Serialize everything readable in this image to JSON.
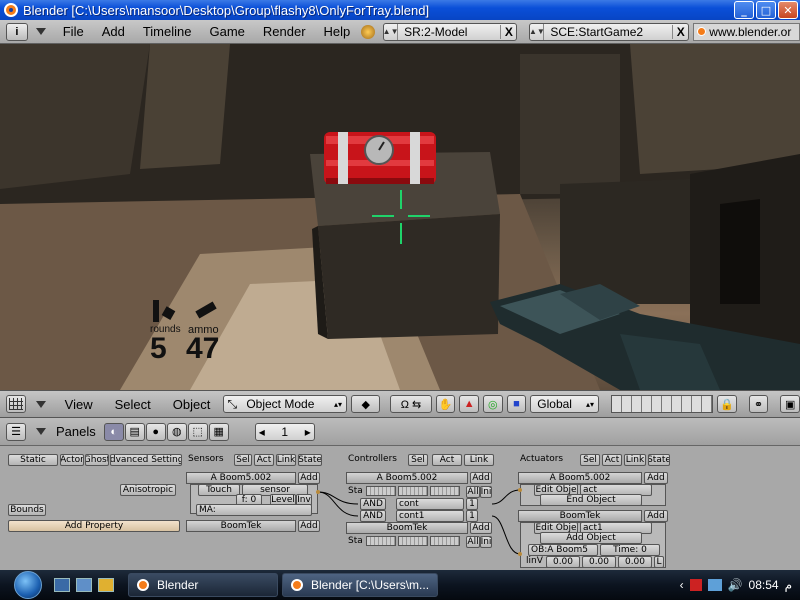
{
  "window": {
    "title": "Blender [C:\\Users\\mansoor\\Desktop\\Group\\flashy8\\OnlyForTray.blend]",
    "min": "_",
    "max": "□",
    "close": "✕"
  },
  "menubar": {
    "info_icon": "i",
    "items": [
      "File",
      "Add",
      "Timeline",
      "Game",
      "Render",
      "Help"
    ],
    "screen_field": "SR:2-Model",
    "scene_field": "SCE:StartGame2",
    "url": "www.blender.or"
  },
  "hud": {
    "rounds_label": "rounds",
    "rounds_value": "5",
    "ammo_label": "ammo",
    "ammo_value": "47"
  },
  "view_header": {
    "menus": [
      "View",
      "Select",
      "Object"
    ],
    "mode": "Object Mode",
    "orientation": "Global"
  },
  "panels_header": {
    "panels_label": "Panels",
    "page_value": "1"
  },
  "logic": {
    "object_buttons": [
      "Static",
      "Actor",
      "Ghost",
      "Advanced Settings"
    ],
    "anisotropic": "Anisotropic",
    "bounds": "Bounds",
    "add_property": "Add Property",
    "sensors": {
      "title": "Sensors",
      "filters": [
        "Sel",
        "Act",
        "Link",
        "State"
      ],
      "object": "A Boom5.002",
      "add": "Add",
      "touch_type": "Touch",
      "touch_name": "sensor",
      "f_value": "f: 0",
      "level": "Level",
      "inv": "Inv",
      "ma": "MA:",
      "object2": "BoomTek",
      "add2": "Add"
    },
    "controllers": {
      "title": "Controllers",
      "filters": [
        "Sel",
        "Act",
        "Link"
      ],
      "object": "A Boom5.002",
      "add": "Add",
      "sta": "Sta",
      "all": "All",
      "ini": "Ini",
      "and1": "AND",
      "cont1": "cont",
      "n1": "1",
      "and2": "AND",
      "cont2": "cont1",
      "n2": "1",
      "object2": "BoomTek",
      "add2": "Add",
      "sta2": "Sta",
      "all2": "All",
      "ini2": "Ini"
    },
    "actuators": {
      "title": "Actuators",
      "filters": [
        "Sel",
        "Act",
        "Link",
        "State"
      ],
      "object": "A Boom5.002",
      "add": "Add",
      "edit1_type": "Edit Obje",
      "edit1_name": "act",
      "edit1_mode": "End Object",
      "object2": "BoomTek",
      "add2": "Add",
      "edit2_type": "Edit Obje",
      "edit2_name": "act1",
      "edit2_mode": "Add Object",
      "ob_field": "OB:A Boom5",
      "time": "Time: 0",
      "linv": "linV",
      "v1": "0.00",
      "v2": "0.00",
      "v3": "0.00",
      "l": "L"
    }
  },
  "taskbar": {
    "task1": "Blender",
    "task2": "Blender [C:\\Users\\m...",
    "time": "08:54",
    "ampm": "م"
  },
  "colors": {
    "xp_title": "#0a4fd8",
    "crosshair": "#1fd36a",
    "tnt_red": "#c8141a"
  }
}
